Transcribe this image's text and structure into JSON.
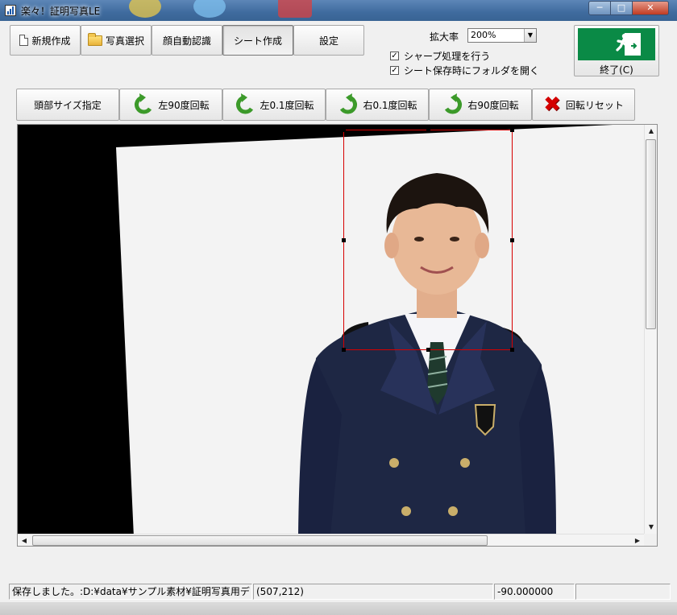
{
  "window": {
    "title": "楽々！証明写真LE",
    "controls": {
      "minimize": "─",
      "maximize": "□",
      "close": "✕"
    }
  },
  "toolbar_top": {
    "new_label": "新規作成",
    "select_photo_label": "写真選択",
    "face_detect_label": "顔自動認識",
    "sheet_create_label": "シート作成",
    "settings_label": "設定"
  },
  "zoom": {
    "label": "拡大率",
    "value": "200%"
  },
  "options": {
    "sharpen": {
      "label": "シャープ処理を行う",
      "checked": true
    },
    "open_folder": {
      "label": "シート保存時にフォルダを開く",
      "checked": true
    }
  },
  "exit": {
    "label": "終了(C)"
  },
  "toolbar_second": {
    "head_size_label": "頭部サイズ指定",
    "rotate_left_90_label": "左90度回転",
    "rotate_left_01_label": "左0.1度回転",
    "rotate_right_01_label": "右0.1度回転",
    "rotate_right_90_label": "右90度回転",
    "rotation_reset_label": "回転リセット"
  },
  "scrollbars": {
    "up": "▲",
    "down": "▼",
    "left": "◀",
    "right": "▶"
  },
  "status": {
    "message": "保存しました。:D:¥data¥サンプル素材¥証明写真用デ",
    "coords": "(507,212)",
    "angle": "-90.000000",
    "extra": ""
  },
  "colors": {
    "crop_border": "#d60000",
    "exit_sign_green": "#0a8a46",
    "rotate_arrow": "#3c9a2a",
    "reset_x": "#d40000"
  }
}
